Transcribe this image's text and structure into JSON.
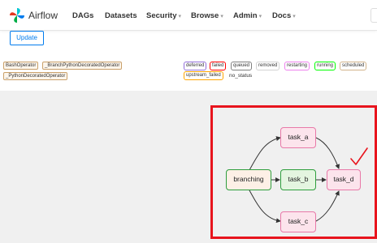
{
  "nav": {
    "brand": "Airflow",
    "items": [
      "DAGs",
      "Datasets",
      "Security",
      "Browse",
      "Admin",
      "Docs"
    ]
  },
  "toolbar": {
    "update_label": "Update"
  },
  "operators": [
    "BashOperator",
    "_BranchPythonDecoratedOperator",
    "_PythonDecoratedOperator"
  ],
  "states": {
    "chips": [
      {
        "label": "deferred",
        "color": "#9370db"
      },
      {
        "label": "failed",
        "color": "#ff0000"
      },
      {
        "label": "queued",
        "color": "#808080"
      },
      {
        "label": "removed",
        "color": "#d3d3d3"
      },
      {
        "label": "restarting",
        "color": "#ee82ee"
      },
      {
        "label": "running",
        "color": "#00ff00"
      },
      {
        "label": "scheduled",
        "color": "#d2b48c"
      },
      {
        "label": "upstream_failed",
        "color": "#ffa500"
      }
    ],
    "no_status": "no_status"
  },
  "graph": {
    "nodes": {
      "branching": "branching",
      "task_a": "task_a",
      "task_b": "task_b",
      "task_c": "task_c",
      "task_d": "task_d"
    },
    "edges": [
      [
        "branching",
        "task_a"
      ],
      [
        "branching",
        "task_b"
      ],
      [
        "branching",
        "task_c"
      ],
      [
        "task_a",
        "task_d"
      ],
      [
        "task_b",
        "task_d"
      ],
      [
        "task_c",
        "task_d"
      ]
    ]
  },
  "colors": {
    "accent": "#017cee",
    "annotation": "#e8141d",
    "pink_node": "#fce4ec",
    "green_border": "#2e9e3d"
  }
}
